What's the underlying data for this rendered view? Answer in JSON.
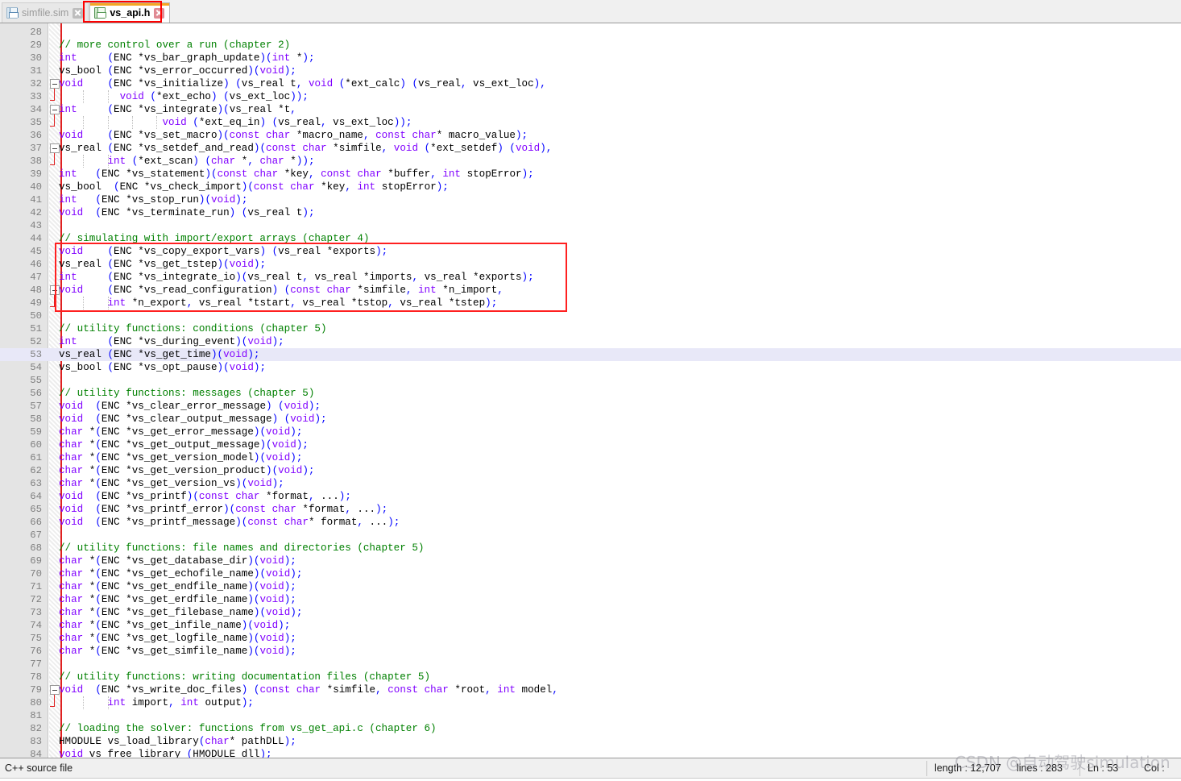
{
  "tabs": [
    {
      "label": "simfile.sim",
      "icon": "floppy-disk-icon",
      "close_icon": "close-icon",
      "active": false
    },
    {
      "label": "vs_api.h",
      "icon": "floppy-disk-icon",
      "close_icon": "close-icon",
      "active": true
    }
  ],
  "annotations": {
    "tab_highlight_color": "#ff0000",
    "code_highlight_color": "#ff2020"
  },
  "editor": {
    "first_line": 28,
    "last_line": 84,
    "current_line": 53,
    "lines": [
      {
        "n": 28,
        "text": ""
      },
      {
        "n": 29,
        "text": "// more control over a run (chapter 2)"
      },
      {
        "n": 30,
        "text": "int     (ENC *vs_bar_graph_update)(int *);"
      },
      {
        "n": 31,
        "text": "vs_bool (ENC *vs_error_occurred)(void);"
      },
      {
        "n": 32,
        "text": "void    (ENC *vs_initialize) (vs_real t, void (*ext_calc) (vs_real, vs_ext_loc),"
      },
      {
        "n": 33,
        "text": "          void (*ext_echo) (vs_ext_loc));"
      },
      {
        "n": 34,
        "text": "int     (ENC *vs_integrate)(vs_real *t,"
      },
      {
        "n": 35,
        "text": "                 void (*ext_eq_in) (vs_real, vs_ext_loc));"
      },
      {
        "n": 36,
        "text": "void    (ENC *vs_set_macro)(const char *macro_name, const char* macro_value);"
      },
      {
        "n": 37,
        "text": "vs_real (ENC *vs_setdef_and_read)(const char *simfile, void (*ext_setdef) (void),"
      },
      {
        "n": 38,
        "text": "        int (*ext_scan) (char *, char *));"
      },
      {
        "n": 39,
        "text": "int   (ENC *vs_statement)(const char *key, const char *buffer, int stopError);"
      },
      {
        "n": 40,
        "text": "vs_bool  (ENC *vs_check_import)(const char *key, int stopError);"
      },
      {
        "n": 41,
        "text": "int   (ENC *vs_stop_run)(void);"
      },
      {
        "n": 42,
        "text": "void  (ENC *vs_terminate_run) (vs_real t);"
      },
      {
        "n": 43,
        "text": ""
      },
      {
        "n": 44,
        "text": "// simulating with import/export arrays (chapter 4)"
      },
      {
        "n": 45,
        "text": "void    (ENC *vs_copy_export_vars) (vs_real *exports);"
      },
      {
        "n": 46,
        "text": "vs_real (ENC *vs_get_tstep)(void);"
      },
      {
        "n": 47,
        "text": "int     (ENC *vs_integrate_io)(vs_real t, vs_real *imports, vs_real *exports);"
      },
      {
        "n": 48,
        "text": "void    (ENC *vs_read_configuration) (const char *simfile, int *n_import,"
      },
      {
        "n": 49,
        "text": "        int *n_export, vs_real *tstart, vs_real *tstop, vs_real *tstep);"
      },
      {
        "n": 50,
        "text": ""
      },
      {
        "n": 51,
        "text": "// utility functions: conditions (chapter 5)"
      },
      {
        "n": 52,
        "text": "int     (ENC *vs_during_event)(void);"
      },
      {
        "n": 53,
        "text": "vs_real (ENC *vs_get_time)(void);"
      },
      {
        "n": 54,
        "text": "vs_bool (ENC *vs_opt_pause)(void);"
      },
      {
        "n": 55,
        "text": ""
      },
      {
        "n": 56,
        "text": "// utility functions: messages (chapter 5)"
      },
      {
        "n": 57,
        "text": "void  (ENC *vs_clear_error_message) (void);"
      },
      {
        "n": 58,
        "text": "void  (ENC *vs_clear_output_message) (void);"
      },
      {
        "n": 59,
        "text": "char *(ENC *vs_get_error_message)(void);"
      },
      {
        "n": 60,
        "text": "char *(ENC *vs_get_output_message)(void);"
      },
      {
        "n": 61,
        "text": "char *(ENC *vs_get_version_model)(void);"
      },
      {
        "n": 62,
        "text": "char *(ENC *vs_get_version_product)(void);"
      },
      {
        "n": 63,
        "text": "char *(ENC *vs_get_version_vs)(void);"
      },
      {
        "n": 64,
        "text": "void  (ENC *vs_printf)(const char *format, ...);"
      },
      {
        "n": 65,
        "text": "void  (ENC *vs_printf_error)(const char *format, ...);"
      },
      {
        "n": 66,
        "text": "void  (ENC *vs_printf_message)(const char* format, ...);"
      },
      {
        "n": 67,
        "text": ""
      },
      {
        "n": 68,
        "text": "// utility functions: file names and directories (chapter 5)"
      },
      {
        "n": 69,
        "text": "char *(ENC *vs_get_database_dir)(void);"
      },
      {
        "n": 70,
        "text": "char *(ENC *vs_get_echofile_name)(void);"
      },
      {
        "n": 71,
        "text": "char *(ENC *vs_get_endfile_name)(void);"
      },
      {
        "n": 72,
        "text": "char *(ENC *vs_get_erdfile_name)(void);"
      },
      {
        "n": 73,
        "text": "char *(ENC *vs_get_filebase_name)(void);"
      },
      {
        "n": 74,
        "text": "char *(ENC *vs_get_infile_name)(void);"
      },
      {
        "n": 75,
        "text": "char *(ENC *vs_get_logfile_name)(void);"
      },
      {
        "n": 76,
        "text": "char *(ENC *vs_get_simfile_name)(void);"
      },
      {
        "n": 77,
        "text": ""
      },
      {
        "n": 78,
        "text": "// utility functions: writing documentation files (chapter 5)"
      },
      {
        "n": 79,
        "text": "void  (ENC *vs_write_doc_files) (const char *simfile, const char *root, int model,"
      },
      {
        "n": 80,
        "text": "        int import, int output);"
      },
      {
        "n": 81,
        "text": ""
      },
      {
        "n": 82,
        "text": "// loading the solver: functions from vs_get_api.c (chapter 6)"
      },
      {
        "n": 83,
        "text": "HMODULE vs_load_library(char* pathDLL);"
      },
      {
        "n": 84,
        "text": "void vs_free_library (HMODULE dll);"
      }
    ],
    "fold_markers": [
      32,
      34,
      37,
      48,
      79
    ],
    "fold_ticks": [
      33,
      35,
      38,
      49,
      80
    ]
  },
  "statusbar": {
    "file_type": "C++ source file",
    "length_label": "length : 12,707",
    "lines_label": "lines : 283",
    "ln_label": "Ln : 53",
    "col_label": "Col :"
  },
  "watermark": {
    "text": "CSDN @自动驾驶simulation"
  }
}
